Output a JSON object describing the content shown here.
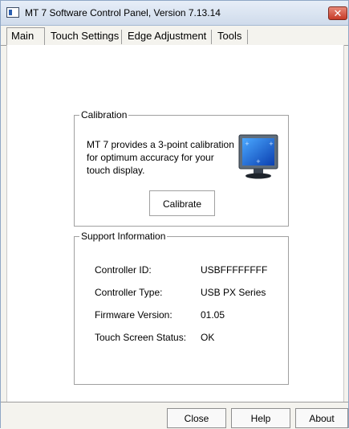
{
  "window": {
    "title": "MT 7 Software Control Panel, Version 7.13.14",
    "close_glyph": "✕"
  },
  "tabs": [
    {
      "label": "Main",
      "active": true
    },
    {
      "label": "Touch Settings",
      "active": false
    },
    {
      "label": "Edge Adjustment",
      "active": false
    },
    {
      "label": "Tools",
      "active": false
    }
  ],
  "calibration": {
    "legend": "Calibration",
    "description": "MT 7 provides a 3-point calibration for optimum accuracy for your touch display.",
    "icon": "monitor-icon",
    "button_label": "Calibrate"
  },
  "support": {
    "legend": "Support Information",
    "rows": [
      {
        "label": "Controller ID:",
        "value": "USBFFFFFFFF"
      },
      {
        "label": "Controller Type:",
        "value": "USB PX Series"
      },
      {
        "label": "Firmware Version:",
        "value": "01.05"
      },
      {
        "label": "Touch Screen Status:",
        "value": "OK"
      }
    ]
  },
  "footer": {
    "close_label": "Close",
    "help_label": "Help",
    "about_label": "About"
  },
  "colors": {
    "panel_bg": "#f4f3ee",
    "content_bg": "#ffffff",
    "close_button": "#c63a26",
    "title_gradient": "#cfdbeb"
  }
}
